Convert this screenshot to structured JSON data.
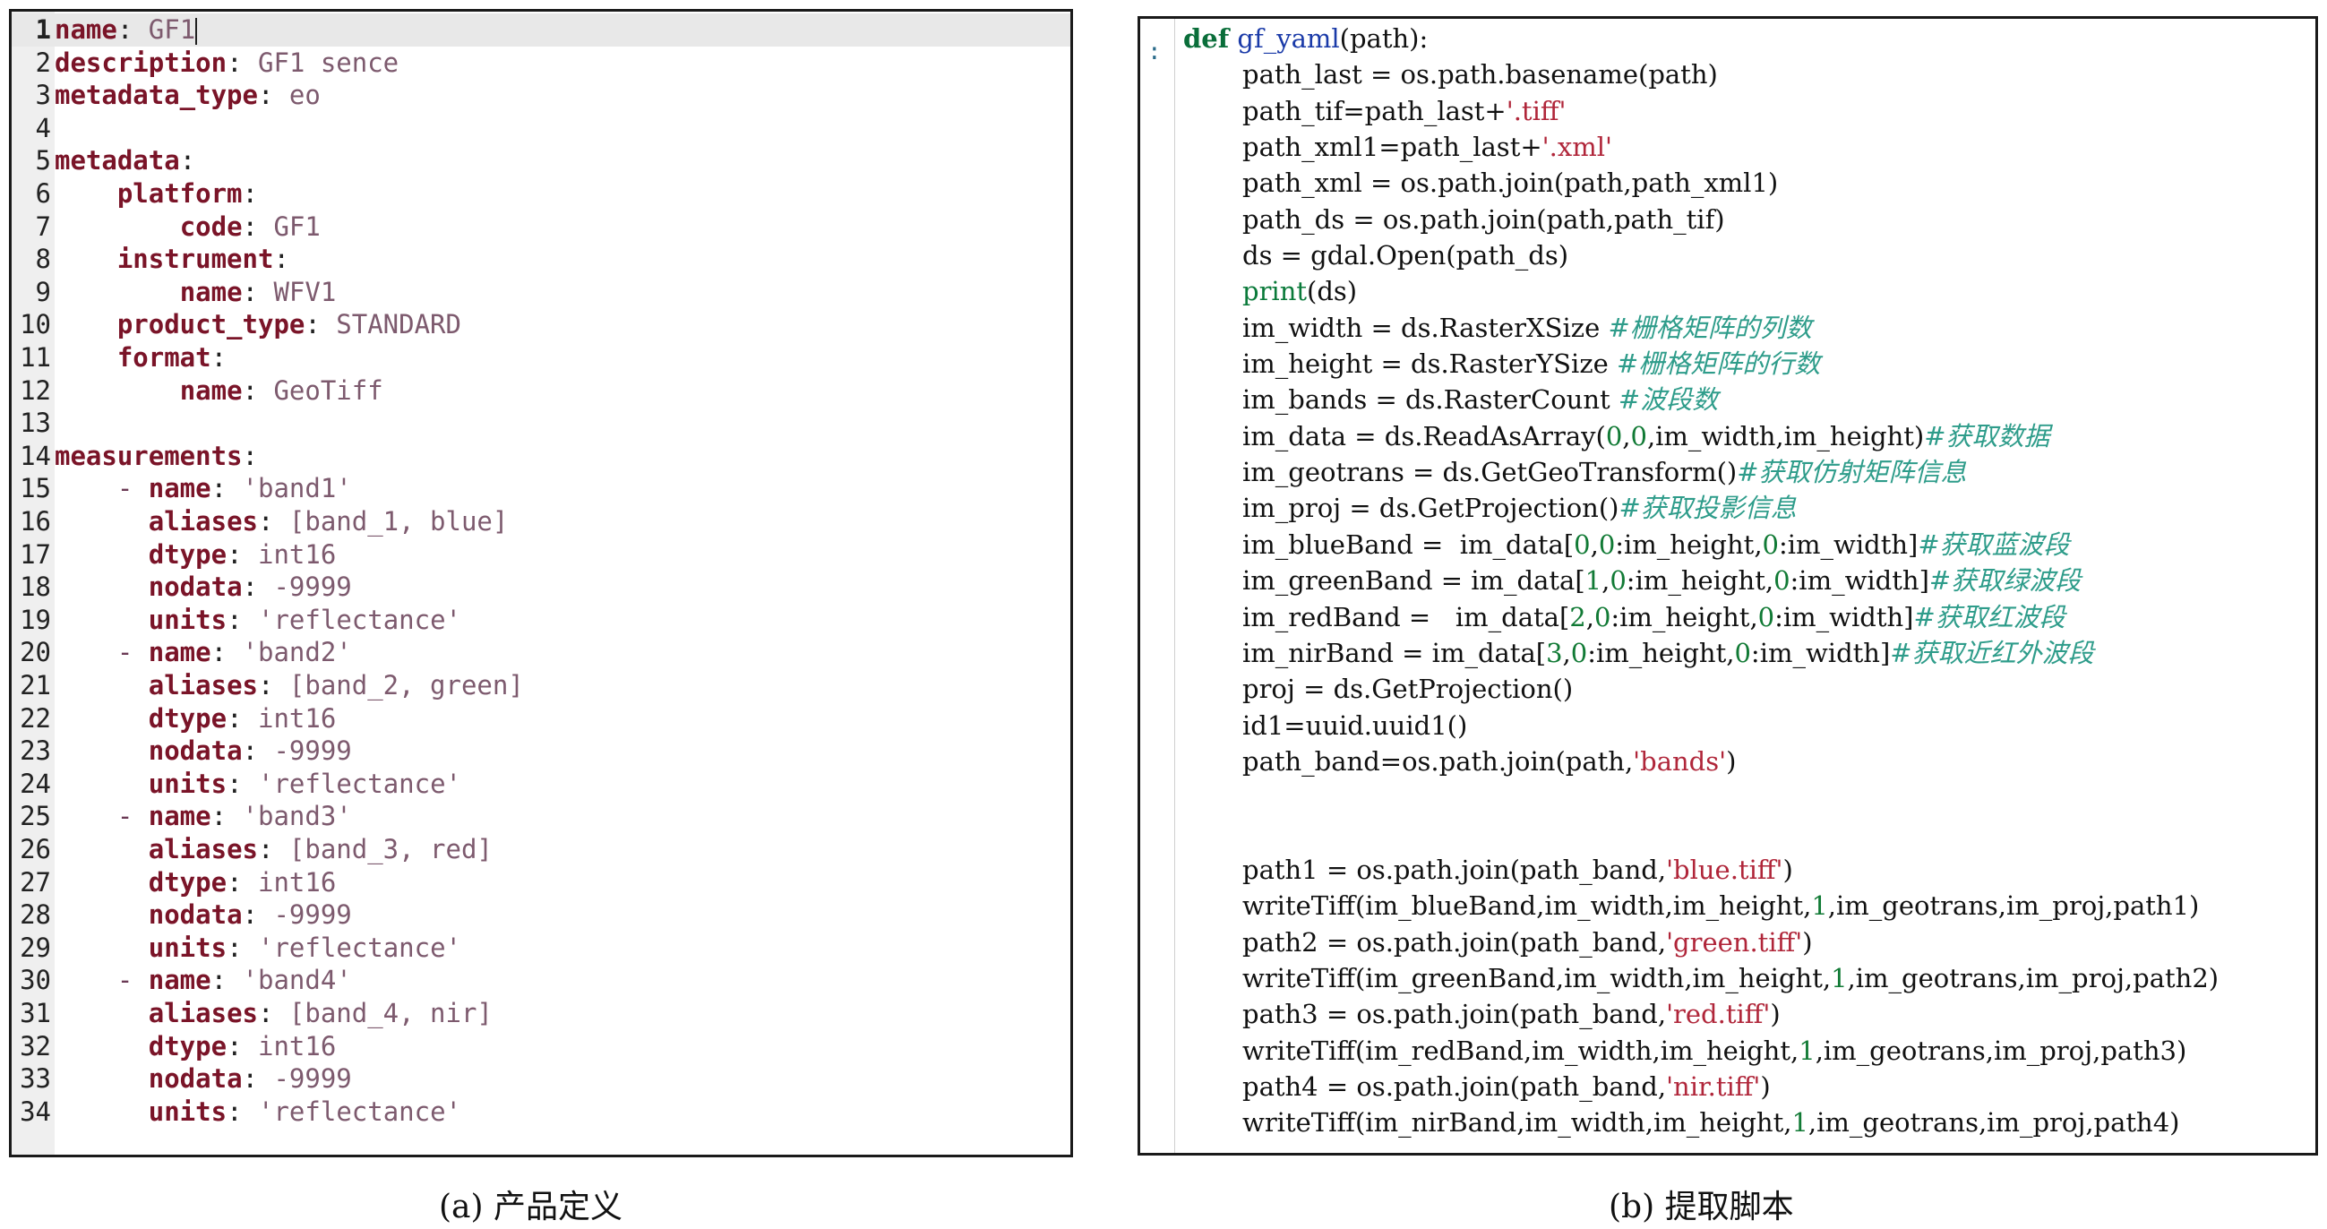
{
  "yaml_editor": {
    "lines": [
      {
        "n": "1",
        "indent": 0,
        "key": "name",
        "value": "GF1",
        "cursor": true
      },
      {
        "n": "2",
        "indent": 0,
        "key": "description",
        "value": "GF1 sence"
      },
      {
        "n": "3",
        "indent": 0,
        "key": "metadata_type",
        "value": "eo"
      },
      {
        "n": "4",
        "indent": 0
      },
      {
        "n": "5",
        "indent": 0,
        "key": "metadata",
        "value": ""
      },
      {
        "n": "6",
        "indent": 4,
        "key": "platform",
        "value": ""
      },
      {
        "n": "7",
        "indent": 8,
        "key": "code",
        "value": "GF1"
      },
      {
        "n": "8",
        "indent": 4,
        "key": "instrument",
        "value": ""
      },
      {
        "n": "9",
        "indent": 8,
        "key": "name",
        "value": "WFV1"
      },
      {
        "n": "10",
        "indent": 4,
        "key": "product_type",
        "value": "STANDARD"
      },
      {
        "n": "11",
        "indent": 4,
        "key": "format",
        "value": ""
      },
      {
        "n": "12",
        "indent": 8,
        "key": "name",
        "value": "GeoTiff"
      },
      {
        "n": "13",
        "indent": 0
      },
      {
        "n": "14",
        "indent": 0,
        "key": "measurements",
        "value": ""
      },
      {
        "n": "15",
        "indent": 4,
        "dash": true,
        "key": "name",
        "value": "'band1'"
      },
      {
        "n": "16",
        "indent": 6,
        "key": "aliases",
        "value": "[band_1, blue]"
      },
      {
        "n": "17",
        "indent": 6,
        "key": "dtype",
        "value": "int16"
      },
      {
        "n": "18",
        "indent": 6,
        "key": "nodata",
        "value": "-9999"
      },
      {
        "n": "19",
        "indent": 6,
        "key": "units",
        "value": "'reflectance'"
      },
      {
        "n": "20",
        "indent": 4,
        "dash": true,
        "key": "name",
        "value": "'band2'"
      },
      {
        "n": "21",
        "indent": 6,
        "key": "aliases",
        "value": "[band_2, green]"
      },
      {
        "n": "22",
        "indent": 6,
        "key": "dtype",
        "value": "int16"
      },
      {
        "n": "23",
        "indent": 6,
        "key": "nodata",
        "value": "-9999"
      },
      {
        "n": "24",
        "indent": 6,
        "key": "units",
        "value": "'reflectance'"
      },
      {
        "n": "25",
        "indent": 4,
        "dash": true,
        "key": "name",
        "value": "'band3'"
      },
      {
        "n": "26",
        "indent": 6,
        "key": "aliases",
        "value": "[band_3, red]"
      },
      {
        "n": "27",
        "indent": 6,
        "key": "dtype",
        "value": "int16"
      },
      {
        "n": "28",
        "indent": 6,
        "key": "nodata",
        "value": "-9999"
      },
      {
        "n": "29",
        "indent": 6,
        "key": "units",
        "value": "'reflectance'"
      },
      {
        "n": "30",
        "indent": 4,
        "dash": true,
        "key": "name",
        "value": "'band4'"
      },
      {
        "n": "31",
        "indent": 6,
        "key": "aliases",
        "value": "[band_4, nir]"
      },
      {
        "n": "32",
        "indent": 6,
        "key": "dtype",
        "value": "int16"
      },
      {
        "n": "33",
        "indent": 6,
        "key": "nodata",
        "value": "-9999"
      },
      {
        "n": "34",
        "indent": 6,
        "key": "units",
        "value": "'reflectance'"
      }
    ]
  },
  "python_script": {
    "prompt": ":",
    "lines": [
      {
        "kind": "def",
        "segments": [
          {
            "t": "def",
            "c": "pk"
          },
          {
            "t": " "
          },
          {
            "t": "gf_yaml",
            "c": "pf"
          },
          {
            "t": "(path):"
          }
        ]
      },
      {
        "segments": [
          {
            "t": "path_last = os.path.basename(path)"
          }
        ]
      },
      {
        "segments": [
          {
            "t": "path_tif=path_last+"
          },
          {
            "t": "'.tiff'",
            "c": "ps"
          }
        ]
      },
      {
        "segments": [
          {
            "t": "path_xml1=path_last+"
          },
          {
            "t": "'.xml'",
            "c": "ps"
          }
        ]
      },
      {
        "segments": [
          {
            "t": "path_xml = os.path.join(path,path_xml1)"
          }
        ]
      },
      {
        "segments": [
          {
            "t": "path_ds = os.path.join(path,path_tif)"
          }
        ]
      },
      {
        "segments": [
          {
            "t": "ds = gdal.Open(path_ds)"
          }
        ]
      },
      {
        "segments": [
          {
            "t": "print",
            "c": "pb"
          },
          {
            "t": "(ds)"
          }
        ]
      },
      {
        "segments": [
          {
            "t": "im_width = ds.RasterXSize "
          },
          {
            "t": "#栅格矩阵的列数",
            "c": "pc"
          }
        ]
      },
      {
        "segments": [
          {
            "t": "im_height = ds.RasterYSize "
          },
          {
            "t": "#栅格矩阵的行数",
            "c": "pc"
          }
        ]
      },
      {
        "segments": [
          {
            "t": "im_bands = ds.RasterCount "
          },
          {
            "t": "#波段数",
            "c": "pc"
          }
        ]
      },
      {
        "segments": [
          {
            "t": "im_data = ds.ReadAsArray("
          },
          {
            "t": "0",
            "c": "pn"
          },
          {
            "t": ","
          },
          {
            "t": "0",
            "c": "pn"
          },
          {
            "t": ",im_width,im_height)"
          },
          {
            "t": "#获取数据",
            "c": "pc"
          }
        ]
      },
      {
        "segments": [
          {
            "t": "im_geotrans = ds.GetGeoTransform()"
          },
          {
            "t": "#获取仿射矩阵信息",
            "c": "pc"
          }
        ]
      },
      {
        "segments": [
          {
            "t": "im_proj = ds.GetProjection()"
          },
          {
            "t": "#获取投影信息",
            "c": "pc"
          }
        ]
      },
      {
        "segments": [
          {
            "t": "im_blueBand =  im_data["
          },
          {
            "t": "0",
            "c": "pn"
          },
          {
            "t": ","
          },
          {
            "t": "0",
            "c": "pn"
          },
          {
            "t": ":im_height,"
          },
          {
            "t": "0",
            "c": "pn"
          },
          {
            "t": ":im_width]"
          },
          {
            "t": "#获取蓝波段",
            "c": "pc"
          }
        ]
      },
      {
        "segments": [
          {
            "t": "im_greenBand = im_data["
          },
          {
            "t": "1",
            "c": "pn"
          },
          {
            "t": ","
          },
          {
            "t": "0",
            "c": "pn"
          },
          {
            "t": ":im_height,"
          },
          {
            "t": "0",
            "c": "pn"
          },
          {
            "t": ":im_width]"
          },
          {
            "t": "#获取绿波段",
            "c": "pc"
          }
        ]
      },
      {
        "segments": [
          {
            "t": "im_redBand =   im_data["
          },
          {
            "t": "2",
            "c": "pn"
          },
          {
            "t": ","
          },
          {
            "t": "0",
            "c": "pn"
          },
          {
            "t": ":im_height,"
          },
          {
            "t": "0",
            "c": "pn"
          },
          {
            "t": ":im_width]"
          },
          {
            "t": "#获取红波段",
            "c": "pc"
          }
        ]
      },
      {
        "segments": [
          {
            "t": "im_nirBand = im_data["
          },
          {
            "t": "3",
            "c": "pn"
          },
          {
            "t": ","
          },
          {
            "t": "0",
            "c": "pn"
          },
          {
            "t": ":im_height,"
          },
          {
            "t": "0",
            "c": "pn"
          },
          {
            "t": ":im_width]"
          },
          {
            "t": "#获取近红外波段",
            "c": "pc"
          }
        ]
      },
      {
        "segments": [
          {
            "t": "proj = ds.GetProjection()"
          }
        ]
      },
      {
        "segments": [
          {
            "t": "id1=uuid.uuid1()"
          }
        ]
      },
      {
        "segments": [
          {
            "t": "path_band=os.path.join(path,"
          },
          {
            "t": "'bands'",
            "c": "ps"
          },
          {
            "t": ")"
          }
        ]
      },
      {
        "blank": true
      },
      {
        "blank": true
      },
      {
        "segments": [
          {
            "t": "path1 = os.path.join(path_band,"
          },
          {
            "t": "'blue.tiff'",
            "c": "ps"
          },
          {
            "t": ")"
          }
        ]
      },
      {
        "segments": [
          {
            "t": "writeTiff(im_blueBand,im_width,im_height,"
          },
          {
            "t": "1",
            "c": "pn"
          },
          {
            "t": ",im_geotrans,im_proj,path1)"
          }
        ]
      },
      {
        "segments": [
          {
            "t": "path2 = os.path.join(path_band,"
          },
          {
            "t": "'green.tiff'",
            "c": "ps"
          },
          {
            "t": ")"
          }
        ]
      },
      {
        "segments": [
          {
            "t": "writeTiff(im_greenBand,im_width,im_height,"
          },
          {
            "t": "1",
            "c": "pn"
          },
          {
            "t": ",im_geotrans,im_proj,path2)"
          }
        ]
      },
      {
        "segments": [
          {
            "t": "path3 = os.path.join(path_band,"
          },
          {
            "t": "'red.tiff'",
            "c": "ps"
          },
          {
            "t": ")"
          }
        ]
      },
      {
        "segments": [
          {
            "t": "writeTiff(im_redBand,im_width,im_height,"
          },
          {
            "t": "1",
            "c": "pn"
          },
          {
            "t": ",im_geotrans,im_proj,path3)"
          }
        ]
      },
      {
        "segments": [
          {
            "t": "path4 = os.path.join(path_band,"
          },
          {
            "t": "'nir.tiff'",
            "c": "ps"
          },
          {
            "t": ")"
          }
        ]
      },
      {
        "segments": [
          {
            "t": "writeTiff(im_nirBand,im_width,im_height,"
          },
          {
            "t": "1",
            "c": "pn"
          },
          {
            "t": ",im_geotrans,im_proj,path4)"
          }
        ]
      }
    ]
  },
  "captions": {
    "left": "(a) 产品定义",
    "right": "(b) 提取脚本"
  },
  "colors": {
    "yaml_key": "#7a1428",
    "yaml_value": "#7d5a6e",
    "py_keyword": "#0a6e3a",
    "py_string": "#b0263a",
    "py_comment": "#2e9c8a"
  }
}
